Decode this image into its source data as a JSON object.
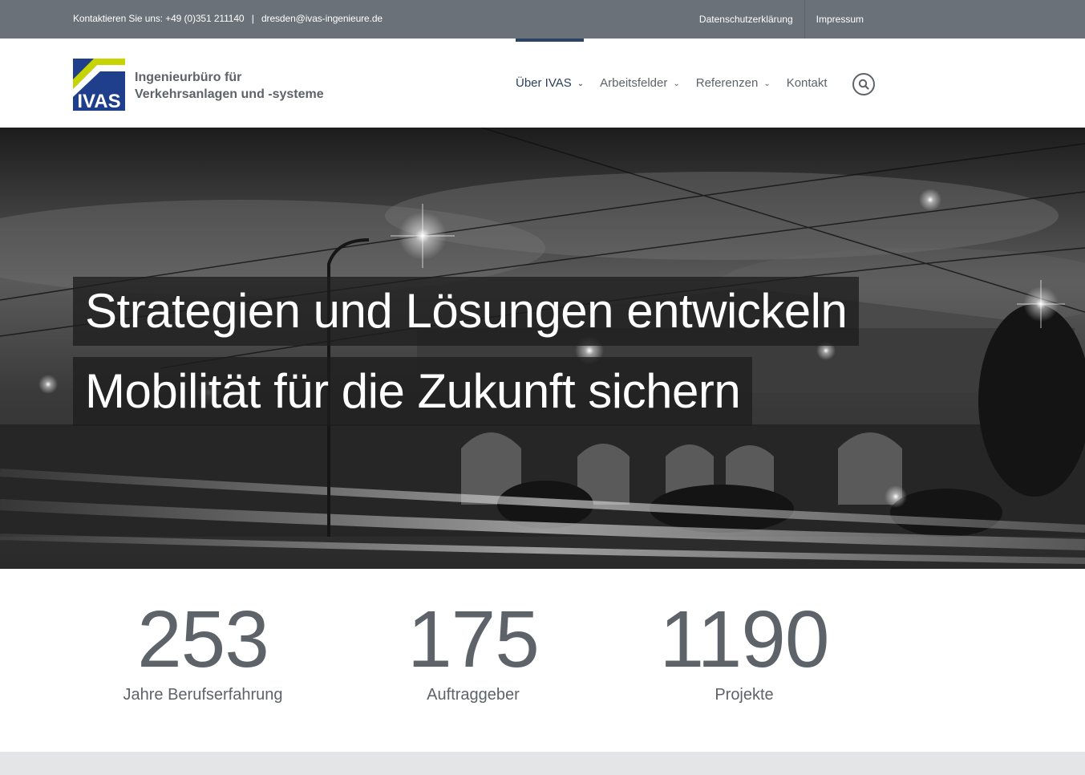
{
  "topbar": {
    "contact_label": "Kontaktieren Sie uns: +49 (0)351 211140",
    "email": "dresden@ivas-ingenieure.de",
    "separator": "|",
    "links": [
      {
        "label": "Datenschutzerklärung"
      },
      {
        "label": "Impressum"
      }
    ]
  },
  "brand": {
    "logo_text": "IVAS",
    "name_line1": "Ingenieurbüro für",
    "name_line2": "Verkehrsanlagen und -systeme",
    "colors": {
      "blue": "#1f3f8c",
      "yellow": "#c8d400"
    }
  },
  "nav": {
    "items": [
      {
        "label": "Über IVAS",
        "has_dropdown": true,
        "active": true
      },
      {
        "label": "Arbeitsfelder",
        "has_dropdown": true
      },
      {
        "label": "Referenzen",
        "has_dropdown": true
      },
      {
        "label": "Kontakt",
        "has_dropdown": false
      }
    ],
    "search_icon": "search-icon",
    "active_color": "#2b4463"
  },
  "hero": {
    "line1": "Strategien und Lösungen entwickeln",
    "line2": "Mobilität für die Zukunft sichern"
  },
  "counters": [
    {
      "value": "253",
      "label": "Jahre Berufserfahrung"
    },
    {
      "value": "175",
      "label": "Auftraggeber"
    },
    {
      "value": "1190",
      "label": "Projekte"
    }
  ]
}
